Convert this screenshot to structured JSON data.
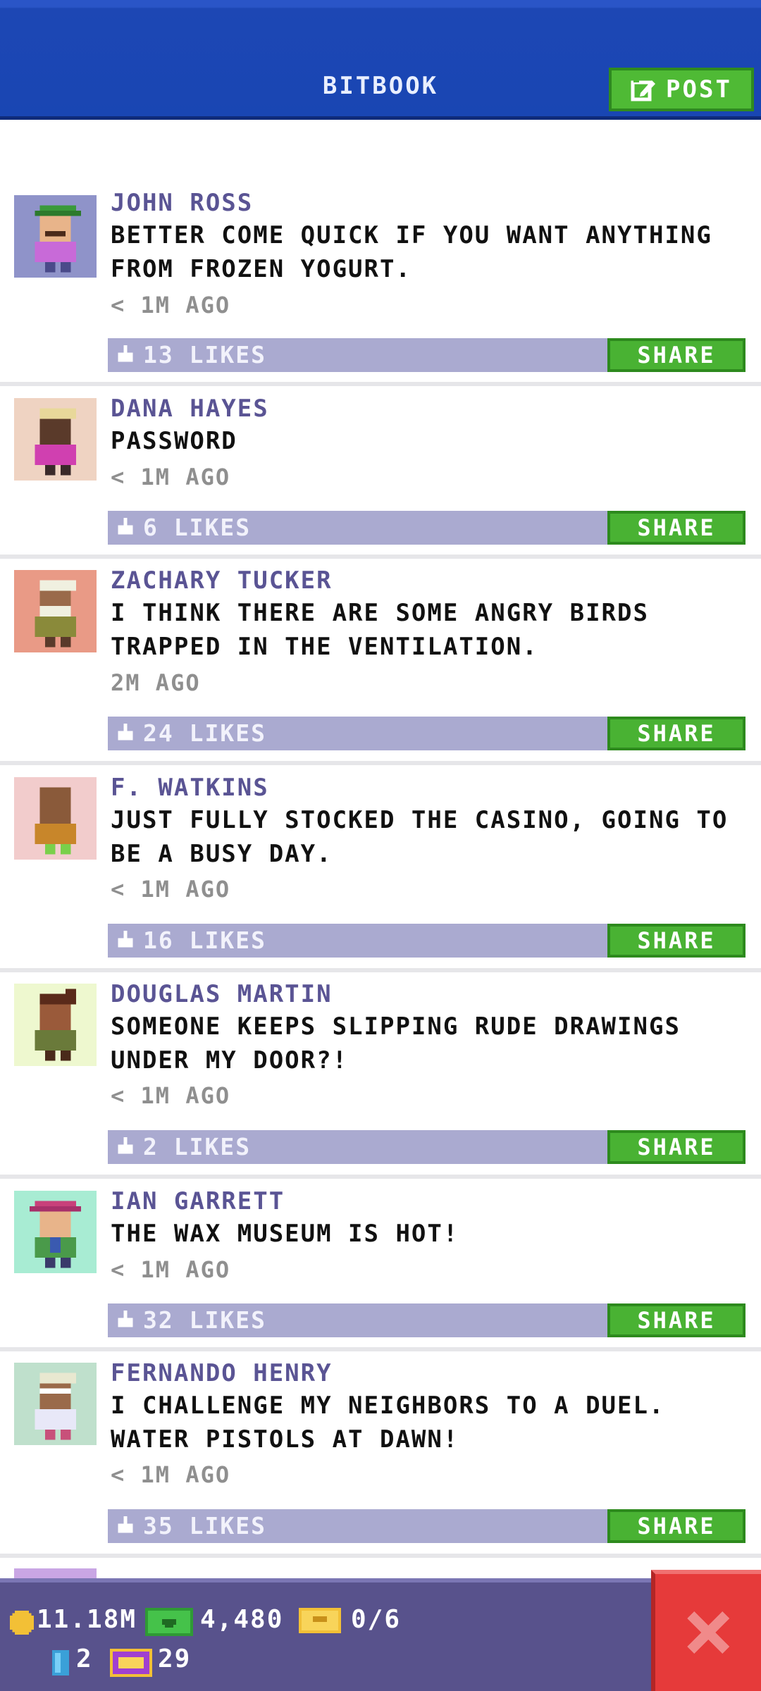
{
  "header": {
    "title": "BITBOOK",
    "post_label": "POST"
  },
  "posts": [
    {
      "name": "JOHN ROSS",
      "message": "BETTER COME QUICK IF YOU WANT ANYTHING FROM FROZEN YOGURT.",
      "time": "< 1M AGO",
      "likes": "13 LIKES",
      "share": "SHARE",
      "avatar_bg": "#8f93c9"
    },
    {
      "name": "DANA HAYES",
      "message": "PASSWORD",
      "time": "< 1M AGO",
      "likes": "6 LIKES",
      "share": "SHARE",
      "avatar_bg": "#efd3c2"
    },
    {
      "name": "ZACHARY TUCKER",
      "message": "I THINK THERE ARE SOME ANGRY BIRDS TRAPPED IN THE VENTILATION.",
      "time": "2M AGO",
      "likes": "24 LIKES",
      "share": "SHARE",
      "avatar_bg": "#e99a86"
    },
    {
      "name": "F. WATKINS",
      "message": "JUST FULLY STOCKED THE CASINO, GOING TO BE A BUSY DAY.",
      "time": "< 1M AGO",
      "likes": "16 LIKES",
      "share": "SHARE",
      "avatar_bg": "#f2cccc"
    },
    {
      "name": "DOUGLAS MARTIN",
      "message": "SOMEONE KEEPS SLIPPING RUDE DRAWINGS UNDER MY DOOR?!",
      "time": "< 1M AGO",
      "likes": "2 LIKES",
      "share": "SHARE",
      "avatar_bg": "#eef8cf"
    },
    {
      "name": "IAN GARRETT",
      "message": "THE WAX MUSEUM IS HOT!",
      "time": "< 1M AGO",
      "likes": "32 LIKES",
      "share": "SHARE",
      "avatar_bg": "#a8ecd3"
    },
    {
      "name": "FERNANDO HENRY",
      "message": "I CHALLENGE MY NEIGHBORS TO A DUEL. WATER PISTOLS AT DAWN!",
      "time": "< 1M AGO",
      "likes": "35 LIKES",
      "share": "SHARE",
      "avatar_bg": "#bfe0cc"
    }
  ],
  "statusbar": {
    "coins": "11.18M",
    "bux": "4,480",
    "tickets": "0/6",
    "elevator": "2",
    "vip": "29"
  }
}
